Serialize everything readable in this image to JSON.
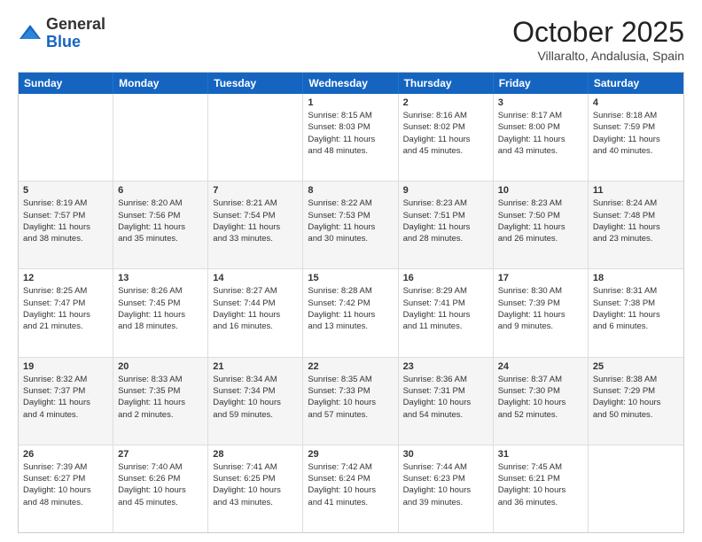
{
  "logo": {
    "general": "General",
    "blue": "Blue"
  },
  "header": {
    "month": "October 2025",
    "location": "Villaralto, Andalusia, Spain"
  },
  "days": [
    "Sunday",
    "Monday",
    "Tuesday",
    "Wednesday",
    "Thursday",
    "Friday",
    "Saturday"
  ],
  "weeks": [
    [
      {
        "day": "",
        "info": ""
      },
      {
        "day": "",
        "info": ""
      },
      {
        "day": "",
        "info": ""
      },
      {
        "day": "1",
        "info": "Sunrise: 8:15 AM\nSunset: 8:03 PM\nDaylight: 11 hours\nand 48 minutes."
      },
      {
        "day": "2",
        "info": "Sunrise: 8:16 AM\nSunset: 8:02 PM\nDaylight: 11 hours\nand 45 minutes."
      },
      {
        "day": "3",
        "info": "Sunrise: 8:17 AM\nSunset: 8:00 PM\nDaylight: 11 hours\nand 43 minutes."
      },
      {
        "day": "4",
        "info": "Sunrise: 8:18 AM\nSunset: 7:59 PM\nDaylight: 11 hours\nand 40 minutes."
      }
    ],
    [
      {
        "day": "5",
        "info": "Sunrise: 8:19 AM\nSunset: 7:57 PM\nDaylight: 11 hours\nand 38 minutes."
      },
      {
        "day": "6",
        "info": "Sunrise: 8:20 AM\nSunset: 7:56 PM\nDaylight: 11 hours\nand 35 minutes."
      },
      {
        "day": "7",
        "info": "Sunrise: 8:21 AM\nSunset: 7:54 PM\nDaylight: 11 hours\nand 33 minutes."
      },
      {
        "day": "8",
        "info": "Sunrise: 8:22 AM\nSunset: 7:53 PM\nDaylight: 11 hours\nand 30 minutes."
      },
      {
        "day": "9",
        "info": "Sunrise: 8:23 AM\nSunset: 7:51 PM\nDaylight: 11 hours\nand 28 minutes."
      },
      {
        "day": "10",
        "info": "Sunrise: 8:23 AM\nSunset: 7:50 PM\nDaylight: 11 hours\nand 26 minutes."
      },
      {
        "day": "11",
        "info": "Sunrise: 8:24 AM\nSunset: 7:48 PM\nDaylight: 11 hours\nand 23 minutes."
      }
    ],
    [
      {
        "day": "12",
        "info": "Sunrise: 8:25 AM\nSunset: 7:47 PM\nDaylight: 11 hours\nand 21 minutes."
      },
      {
        "day": "13",
        "info": "Sunrise: 8:26 AM\nSunset: 7:45 PM\nDaylight: 11 hours\nand 18 minutes."
      },
      {
        "day": "14",
        "info": "Sunrise: 8:27 AM\nSunset: 7:44 PM\nDaylight: 11 hours\nand 16 minutes."
      },
      {
        "day": "15",
        "info": "Sunrise: 8:28 AM\nSunset: 7:42 PM\nDaylight: 11 hours\nand 13 minutes."
      },
      {
        "day": "16",
        "info": "Sunrise: 8:29 AM\nSunset: 7:41 PM\nDaylight: 11 hours\nand 11 minutes."
      },
      {
        "day": "17",
        "info": "Sunrise: 8:30 AM\nSunset: 7:39 PM\nDaylight: 11 hours\nand 9 minutes."
      },
      {
        "day": "18",
        "info": "Sunrise: 8:31 AM\nSunset: 7:38 PM\nDaylight: 11 hours\nand 6 minutes."
      }
    ],
    [
      {
        "day": "19",
        "info": "Sunrise: 8:32 AM\nSunset: 7:37 PM\nDaylight: 11 hours\nand 4 minutes."
      },
      {
        "day": "20",
        "info": "Sunrise: 8:33 AM\nSunset: 7:35 PM\nDaylight: 11 hours\nand 2 minutes."
      },
      {
        "day": "21",
        "info": "Sunrise: 8:34 AM\nSunset: 7:34 PM\nDaylight: 10 hours\nand 59 minutes."
      },
      {
        "day": "22",
        "info": "Sunrise: 8:35 AM\nSunset: 7:33 PM\nDaylight: 10 hours\nand 57 minutes."
      },
      {
        "day": "23",
        "info": "Sunrise: 8:36 AM\nSunset: 7:31 PM\nDaylight: 10 hours\nand 54 minutes."
      },
      {
        "day": "24",
        "info": "Sunrise: 8:37 AM\nSunset: 7:30 PM\nDaylight: 10 hours\nand 52 minutes."
      },
      {
        "day": "25",
        "info": "Sunrise: 8:38 AM\nSunset: 7:29 PM\nDaylight: 10 hours\nand 50 minutes."
      }
    ],
    [
      {
        "day": "26",
        "info": "Sunrise: 7:39 AM\nSunset: 6:27 PM\nDaylight: 10 hours\nand 48 minutes."
      },
      {
        "day": "27",
        "info": "Sunrise: 7:40 AM\nSunset: 6:26 PM\nDaylight: 10 hours\nand 45 minutes."
      },
      {
        "day": "28",
        "info": "Sunrise: 7:41 AM\nSunset: 6:25 PM\nDaylight: 10 hours\nand 43 minutes."
      },
      {
        "day": "29",
        "info": "Sunrise: 7:42 AM\nSunset: 6:24 PM\nDaylight: 10 hours\nand 41 minutes."
      },
      {
        "day": "30",
        "info": "Sunrise: 7:44 AM\nSunset: 6:23 PM\nDaylight: 10 hours\nand 39 minutes."
      },
      {
        "day": "31",
        "info": "Sunrise: 7:45 AM\nSunset: 6:21 PM\nDaylight: 10 hours\nand 36 minutes."
      },
      {
        "day": "",
        "info": ""
      }
    ]
  ],
  "alt_rows": [
    1,
    3
  ]
}
